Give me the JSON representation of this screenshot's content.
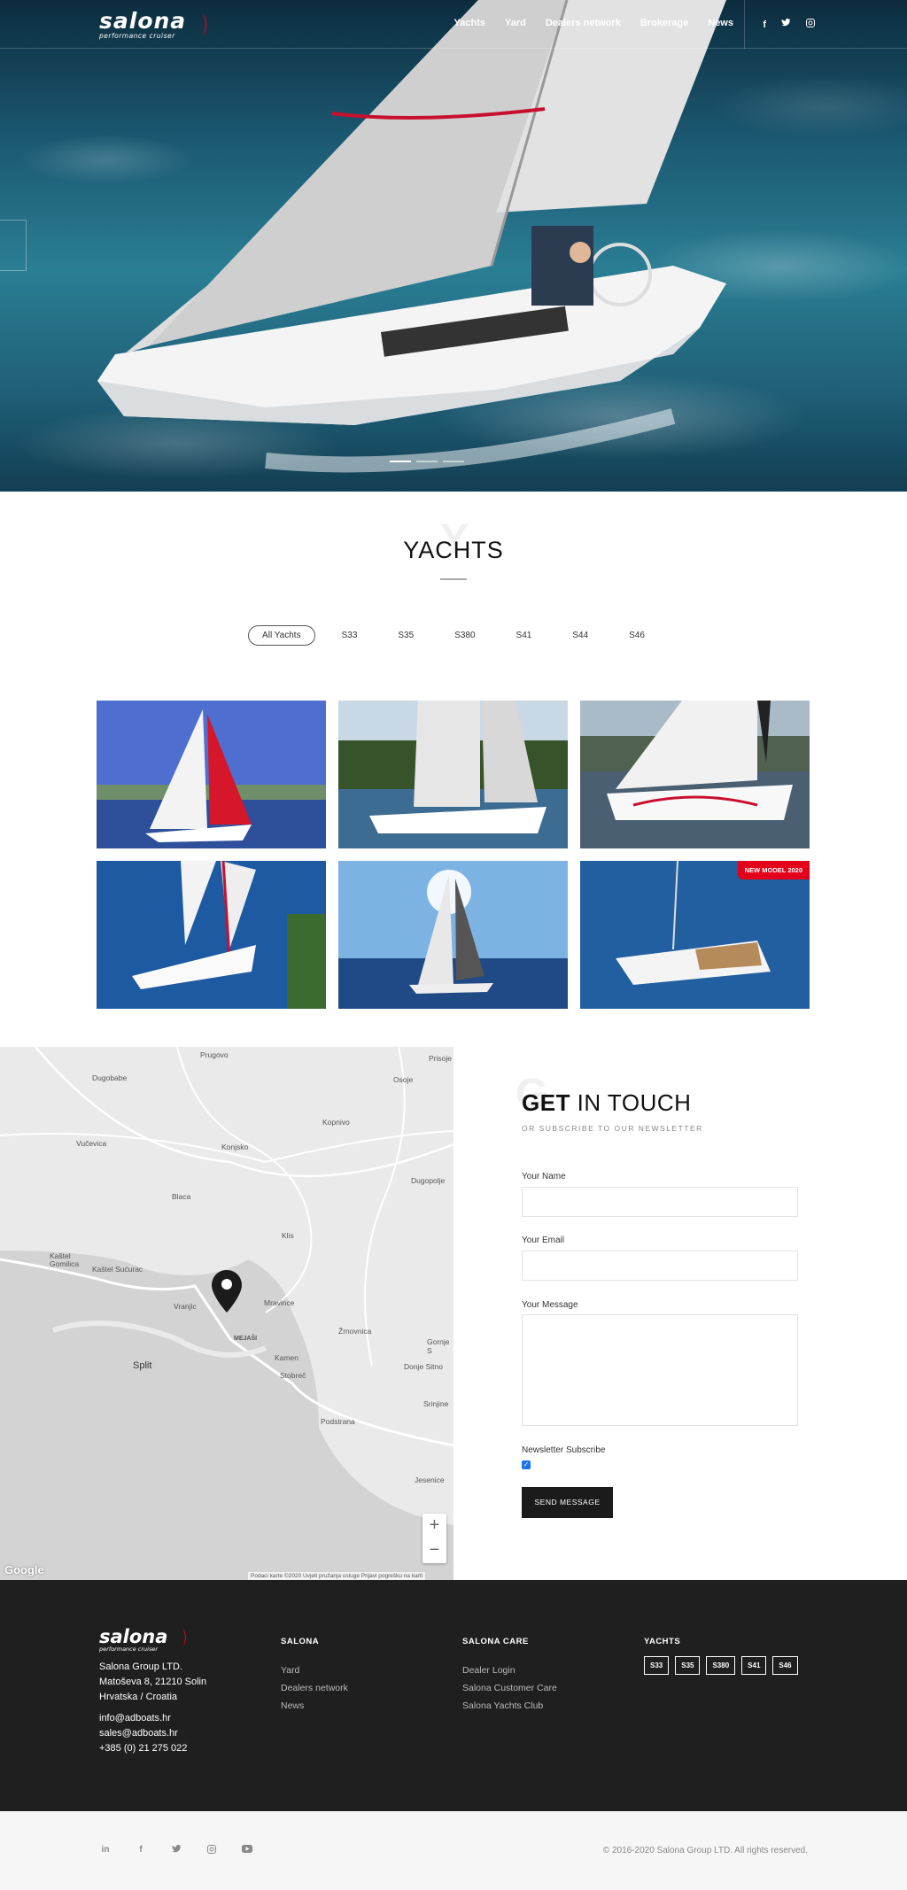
{
  "header": {
    "logo_word": "salona",
    "logo_tag": "performance cruiser",
    "menu": [
      "Yachts",
      "Yard",
      "Dealers network",
      "Brokerage",
      "News"
    ],
    "social_icons": [
      "facebook-icon",
      "twitter-icon",
      "instagram-icon"
    ]
  },
  "yachts": {
    "ghost_letter": "Y",
    "title": "YACHTS",
    "filters": [
      "All Yachts",
      "S33",
      "S35",
      "S380",
      "S41",
      "S44",
      "S46"
    ],
    "active_filter": "All Yachts",
    "badge": "NEW MODEL 2020"
  },
  "map": {
    "places": [
      "Prugovo",
      "Dugobabe",
      "Osoje",
      "Prisoje",
      "Kopnivo",
      "Vučevica",
      "Konjsko",
      "Dugopolje",
      "Blaca",
      "Klis",
      "Kaštel Gomilica",
      "Kaštel Sućurac",
      "Vranjic",
      "Mravince",
      "Žrnovnica",
      "MEJAŠI",
      "Kamen",
      "Gornje S",
      "Split",
      "Stobreč",
      "Donje Sitno",
      "Srinjine",
      "Podstrana",
      "Jesenice"
    ],
    "zoom_in": "+",
    "zoom_out": "−",
    "footer_notes": "Podaci karte ©2020    Uvjeti pružanja usluge    Prijavi pogrešku na karti",
    "brand": "Google"
  },
  "contact": {
    "ghost_letter": "G",
    "title_bold": "GET",
    "title_rest": " IN TOUCH",
    "subtitle": "OR SUBSCRIBE TO OUR NEWSLETTER",
    "name_label": "Your Name",
    "email_label": "Your Email",
    "message_label": "Your Message",
    "newsletter_label": "Newsletter Subscribe",
    "newsletter_checked": true,
    "send_label": "SEND MESSAGE"
  },
  "footer": {
    "logo_word": "salona",
    "logo_tag": "performance cruiser",
    "address": [
      "Salona Group LTD.",
      "Matoševa 8, 21210 Solin",
      "Hrvatska / Croatia"
    ],
    "contacts": [
      "info@adboats.hr",
      "sales@adboats.hr",
      "+385 (0) 21 275 022"
    ],
    "salona": {
      "heading": "SALONA",
      "links": [
        "Yard",
        "Dealers network",
        "News"
      ]
    },
    "care": {
      "heading": "SALONA CARE",
      "links": [
        "Dealer Login",
        "Salona Customer Care",
        "Salona Yachts Club"
      ]
    },
    "yachts": {
      "heading": "YACHTS",
      "chips": [
        "S33",
        "S35",
        "S380",
        "S41",
        "S46"
      ]
    },
    "bottom_social": [
      "in",
      "f",
      "t",
      "ig",
      "yt"
    ],
    "copyright": "© 2016-2020 Salona Group LTD. All rights reserved.",
    "accent": "#e2001a"
  }
}
